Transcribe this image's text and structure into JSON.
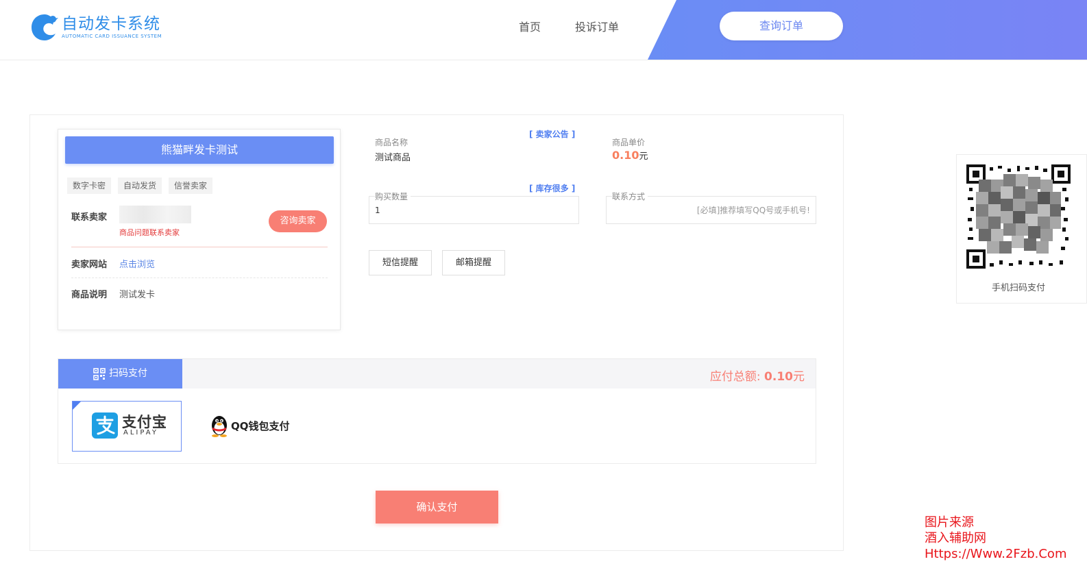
{
  "header": {
    "logo_title": "自动发卡系统",
    "logo_subtitle": "AUTOMATIC CARD ISSUANCE SYSTEM",
    "nav": [
      {
        "label": "首页"
      },
      {
        "label": "投诉订单"
      }
    ],
    "query_button": "查询订单",
    "accent_color": "#6a8ef4"
  },
  "seller": {
    "title": "熊猫畔发卡测试",
    "tags": [
      "数字卡密",
      "自动发货",
      "信誉卖家"
    ],
    "contact_label": "联系卖家",
    "contact_warning": "商品问题联系卖家",
    "consult_button": "咨询卖家",
    "website_label": "卖家网站",
    "website_link": "点击浏览",
    "desc_label": "商品说明",
    "desc_value": "测试发卡"
  },
  "product": {
    "announcement_link": "[ 卖家公告 ]",
    "name_label": "商品名称",
    "name_value": "测试商品",
    "price_label": "商品单价",
    "price_value": "0.10",
    "price_unit": "元",
    "stock_link": "[ 库存很多 ]",
    "quantity_label": "购买数量",
    "quantity_value": "1",
    "contact_label": "联系方式",
    "contact_placeholder": "[必填]推荐填写QQ号或手机号!",
    "sms_button": "短信提醒",
    "email_button": "邮箱提醒"
  },
  "payment": {
    "tab_label": "扫码支付",
    "total_label": "应付总额:",
    "total_value": "0.10",
    "total_unit": "元",
    "alipay_name": "支付宝",
    "alipay_sub": "ALIPAY",
    "qq_name": "QQ钱包支付",
    "confirm_button": "确认支付"
  },
  "qr": {
    "caption": "手机扫码支付"
  },
  "watermark": {
    "line1": "图片来源",
    "line2": "酒入辅助网",
    "line3": "Https://Www.2Fzb.Com"
  }
}
